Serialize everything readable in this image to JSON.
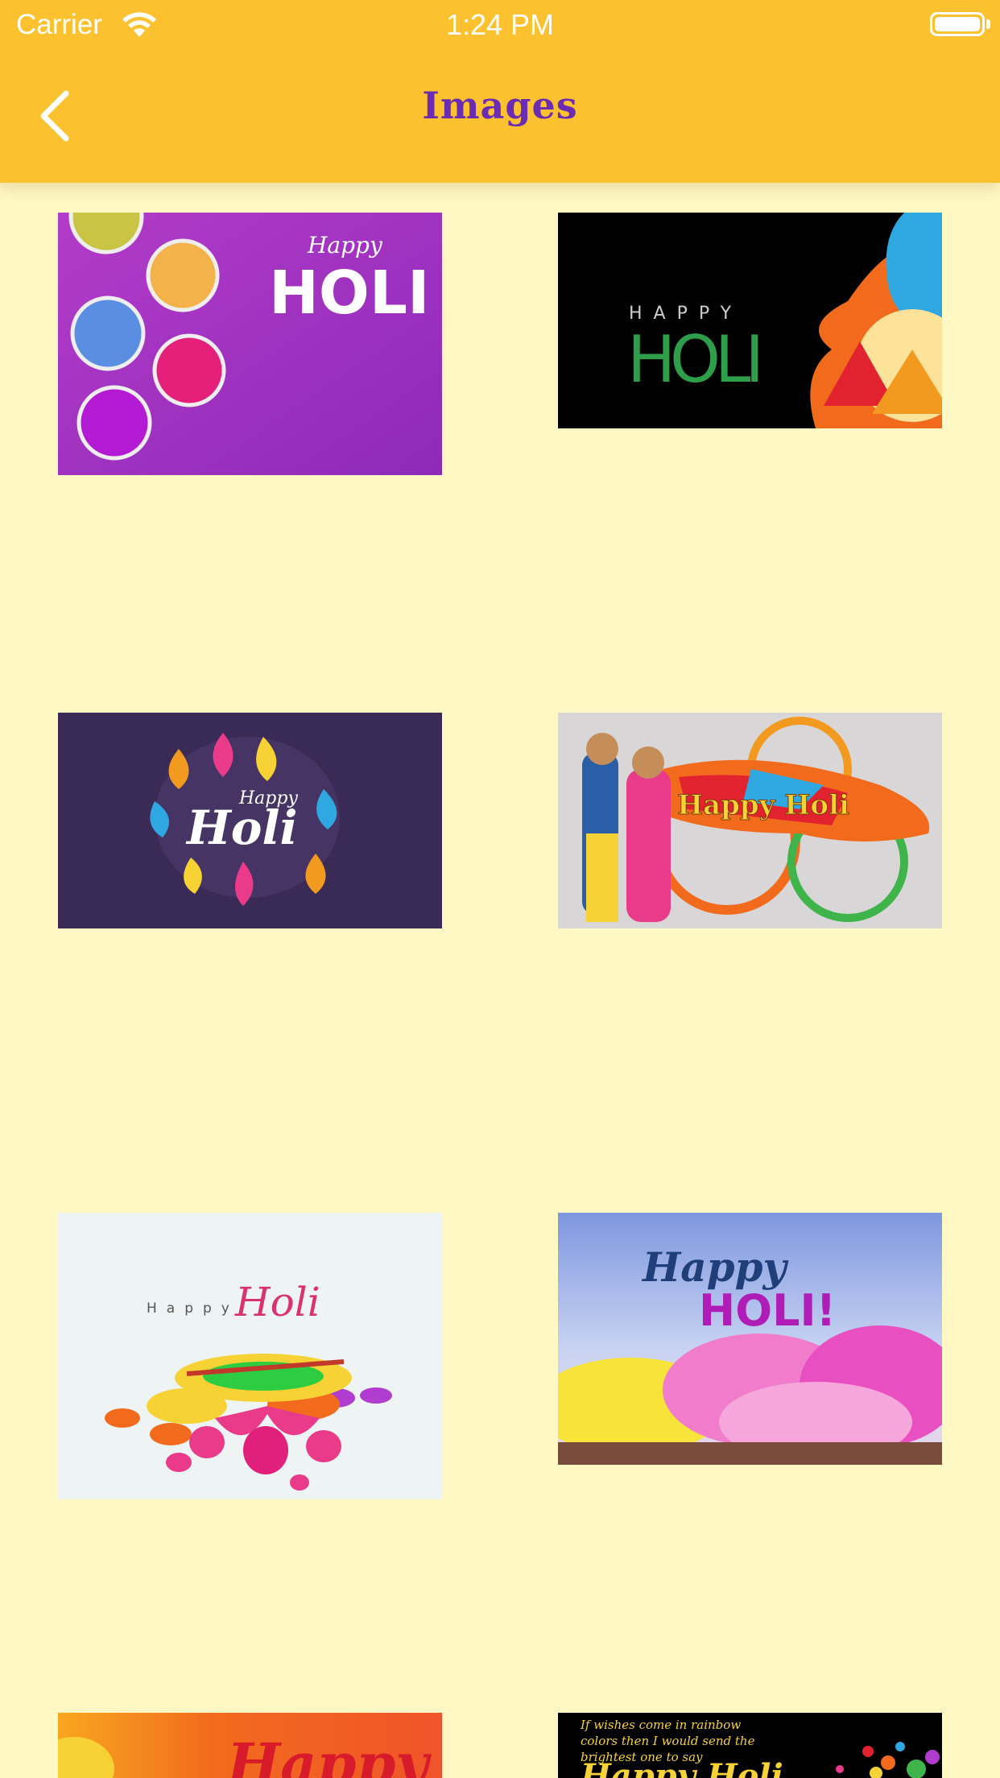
{
  "status_bar": {
    "carrier": "Carrier",
    "time": "1:24 PM"
  },
  "nav": {
    "title": "Images",
    "back_icon": "chevron-left-icon"
  },
  "colors": {
    "nav_bar": "#FCC12E",
    "background": "#FFF7C4",
    "title": "#6B2BB2"
  },
  "images": [
    {
      "id": "holi-1",
      "small": "Happy",
      "big": "HOLI"
    },
    {
      "id": "holi-2",
      "small": "HAPPY",
      "big": "HOLI"
    },
    {
      "id": "holi-3",
      "small": "Happy",
      "big": "Holi"
    },
    {
      "id": "holi-4",
      "text": "Happy Holi"
    },
    {
      "id": "holi-5",
      "small": "Happy",
      "big": "Holi"
    },
    {
      "id": "holi-6",
      "small": "Happy",
      "big": "HOLI!"
    },
    {
      "id": "holi-7",
      "big": "Happy"
    },
    {
      "id": "holi-8",
      "lines": [
        "If wishes come in rainbow",
        "colors then I would send the",
        "brightest one to say"
      ],
      "big": "Happy Holi"
    }
  ]
}
